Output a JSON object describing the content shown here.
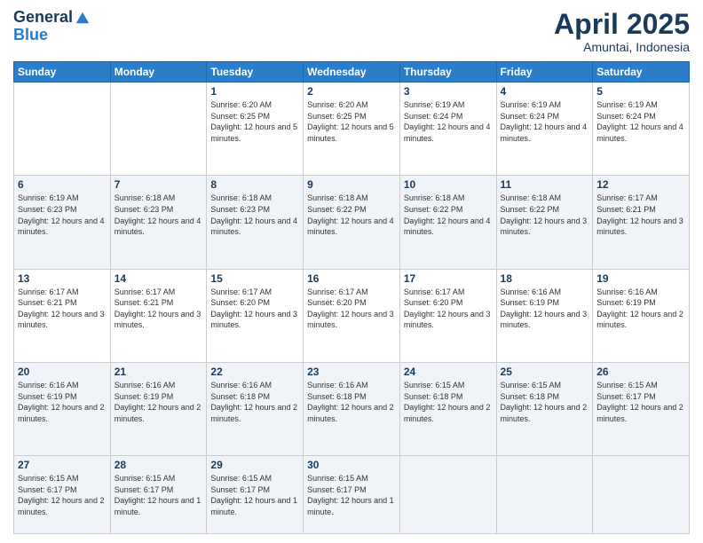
{
  "header": {
    "logo_line1": "General",
    "logo_line2": "Blue",
    "title": "April 2025",
    "subtitle": "Amuntai, Indonesia"
  },
  "weekdays": [
    "Sunday",
    "Monday",
    "Tuesday",
    "Wednesday",
    "Thursday",
    "Friday",
    "Saturday"
  ],
  "weeks": [
    [
      {
        "day": "",
        "sunrise": "",
        "sunset": "",
        "daylight": ""
      },
      {
        "day": "",
        "sunrise": "",
        "sunset": "",
        "daylight": ""
      },
      {
        "day": "1",
        "sunrise": "Sunrise: 6:20 AM",
        "sunset": "Sunset: 6:25 PM",
        "daylight": "Daylight: 12 hours and 5 minutes."
      },
      {
        "day": "2",
        "sunrise": "Sunrise: 6:20 AM",
        "sunset": "Sunset: 6:25 PM",
        "daylight": "Daylight: 12 hours and 5 minutes."
      },
      {
        "day": "3",
        "sunrise": "Sunrise: 6:19 AM",
        "sunset": "Sunset: 6:24 PM",
        "daylight": "Daylight: 12 hours and 4 minutes."
      },
      {
        "day": "4",
        "sunrise": "Sunrise: 6:19 AM",
        "sunset": "Sunset: 6:24 PM",
        "daylight": "Daylight: 12 hours and 4 minutes."
      },
      {
        "day": "5",
        "sunrise": "Sunrise: 6:19 AM",
        "sunset": "Sunset: 6:24 PM",
        "daylight": "Daylight: 12 hours and 4 minutes."
      }
    ],
    [
      {
        "day": "6",
        "sunrise": "Sunrise: 6:19 AM",
        "sunset": "Sunset: 6:23 PM",
        "daylight": "Daylight: 12 hours and 4 minutes."
      },
      {
        "day": "7",
        "sunrise": "Sunrise: 6:18 AM",
        "sunset": "Sunset: 6:23 PM",
        "daylight": "Daylight: 12 hours and 4 minutes."
      },
      {
        "day": "8",
        "sunrise": "Sunrise: 6:18 AM",
        "sunset": "Sunset: 6:23 PM",
        "daylight": "Daylight: 12 hours and 4 minutes."
      },
      {
        "day": "9",
        "sunrise": "Sunrise: 6:18 AM",
        "sunset": "Sunset: 6:22 PM",
        "daylight": "Daylight: 12 hours and 4 minutes."
      },
      {
        "day": "10",
        "sunrise": "Sunrise: 6:18 AM",
        "sunset": "Sunset: 6:22 PM",
        "daylight": "Daylight: 12 hours and 4 minutes."
      },
      {
        "day": "11",
        "sunrise": "Sunrise: 6:18 AM",
        "sunset": "Sunset: 6:22 PM",
        "daylight": "Daylight: 12 hours and 3 minutes."
      },
      {
        "day": "12",
        "sunrise": "Sunrise: 6:17 AM",
        "sunset": "Sunset: 6:21 PM",
        "daylight": "Daylight: 12 hours and 3 minutes."
      }
    ],
    [
      {
        "day": "13",
        "sunrise": "Sunrise: 6:17 AM",
        "sunset": "Sunset: 6:21 PM",
        "daylight": "Daylight: 12 hours and 3 minutes."
      },
      {
        "day": "14",
        "sunrise": "Sunrise: 6:17 AM",
        "sunset": "Sunset: 6:21 PM",
        "daylight": "Daylight: 12 hours and 3 minutes."
      },
      {
        "day": "15",
        "sunrise": "Sunrise: 6:17 AM",
        "sunset": "Sunset: 6:20 PM",
        "daylight": "Daylight: 12 hours and 3 minutes."
      },
      {
        "day": "16",
        "sunrise": "Sunrise: 6:17 AM",
        "sunset": "Sunset: 6:20 PM",
        "daylight": "Daylight: 12 hours and 3 minutes."
      },
      {
        "day": "17",
        "sunrise": "Sunrise: 6:17 AM",
        "sunset": "Sunset: 6:20 PM",
        "daylight": "Daylight: 12 hours and 3 minutes."
      },
      {
        "day": "18",
        "sunrise": "Sunrise: 6:16 AM",
        "sunset": "Sunset: 6:19 PM",
        "daylight": "Daylight: 12 hours and 3 minutes."
      },
      {
        "day": "19",
        "sunrise": "Sunrise: 6:16 AM",
        "sunset": "Sunset: 6:19 PM",
        "daylight": "Daylight: 12 hours and 2 minutes."
      }
    ],
    [
      {
        "day": "20",
        "sunrise": "Sunrise: 6:16 AM",
        "sunset": "Sunset: 6:19 PM",
        "daylight": "Daylight: 12 hours and 2 minutes."
      },
      {
        "day": "21",
        "sunrise": "Sunrise: 6:16 AM",
        "sunset": "Sunset: 6:19 PM",
        "daylight": "Daylight: 12 hours and 2 minutes."
      },
      {
        "day": "22",
        "sunrise": "Sunrise: 6:16 AM",
        "sunset": "Sunset: 6:18 PM",
        "daylight": "Daylight: 12 hours and 2 minutes."
      },
      {
        "day": "23",
        "sunrise": "Sunrise: 6:16 AM",
        "sunset": "Sunset: 6:18 PM",
        "daylight": "Daylight: 12 hours and 2 minutes."
      },
      {
        "day": "24",
        "sunrise": "Sunrise: 6:15 AM",
        "sunset": "Sunset: 6:18 PM",
        "daylight": "Daylight: 12 hours and 2 minutes."
      },
      {
        "day": "25",
        "sunrise": "Sunrise: 6:15 AM",
        "sunset": "Sunset: 6:18 PM",
        "daylight": "Daylight: 12 hours and 2 minutes."
      },
      {
        "day": "26",
        "sunrise": "Sunrise: 6:15 AM",
        "sunset": "Sunset: 6:17 PM",
        "daylight": "Daylight: 12 hours and 2 minutes."
      }
    ],
    [
      {
        "day": "27",
        "sunrise": "Sunrise: 6:15 AM",
        "sunset": "Sunset: 6:17 PM",
        "daylight": "Daylight: 12 hours and 2 minutes."
      },
      {
        "day": "28",
        "sunrise": "Sunrise: 6:15 AM",
        "sunset": "Sunset: 6:17 PM",
        "daylight": "Daylight: 12 hours and 1 minute."
      },
      {
        "day": "29",
        "sunrise": "Sunrise: 6:15 AM",
        "sunset": "Sunset: 6:17 PM",
        "daylight": "Daylight: 12 hours and 1 minute."
      },
      {
        "day": "30",
        "sunrise": "Sunrise: 6:15 AM",
        "sunset": "Sunset: 6:17 PM",
        "daylight": "Daylight: 12 hours and 1 minute."
      },
      {
        "day": "",
        "sunrise": "",
        "sunset": "",
        "daylight": ""
      },
      {
        "day": "",
        "sunrise": "",
        "sunset": "",
        "daylight": ""
      },
      {
        "day": "",
        "sunrise": "",
        "sunset": "",
        "daylight": ""
      }
    ]
  ]
}
